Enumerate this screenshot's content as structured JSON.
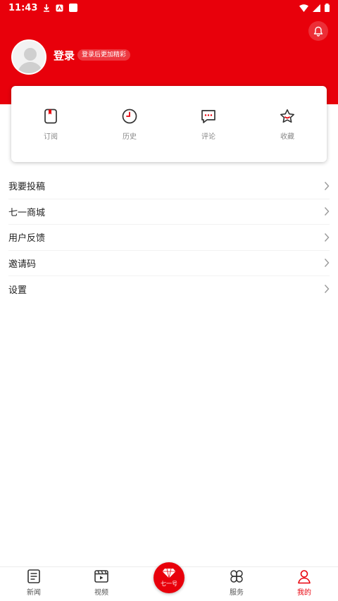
{
  "status_bar": {
    "time": "11:43"
  },
  "profile": {
    "login_label": "登录",
    "login_hint": "登录后更加精彩"
  },
  "quick_actions": [
    {
      "label": "订阅",
      "icon": "subscribe-icon"
    },
    {
      "label": "历史",
      "icon": "clock-icon"
    },
    {
      "label": "评论",
      "icon": "comment-icon"
    },
    {
      "label": "收藏",
      "icon": "star-icon"
    }
  ],
  "menu": [
    {
      "label": "我要投稿"
    },
    {
      "label": "七一商城"
    },
    {
      "label": "用户反馈"
    },
    {
      "label": "邀请码"
    },
    {
      "label": "设置"
    }
  ],
  "tabs": [
    {
      "label": "新闻",
      "icon": "news-icon"
    },
    {
      "label": "视频",
      "icon": "video-icon"
    },
    {
      "label": "七一号",
      "icon": "diamond-icon"
    },
    {
      "label": "服务",
      "icon": "services-icon"
    },
    {
      "label": "我的",
      "icon": "user-icon",
      "active": true
    }
  ],
  "colors": {
    "brand": "#e8000b"
  }
}
